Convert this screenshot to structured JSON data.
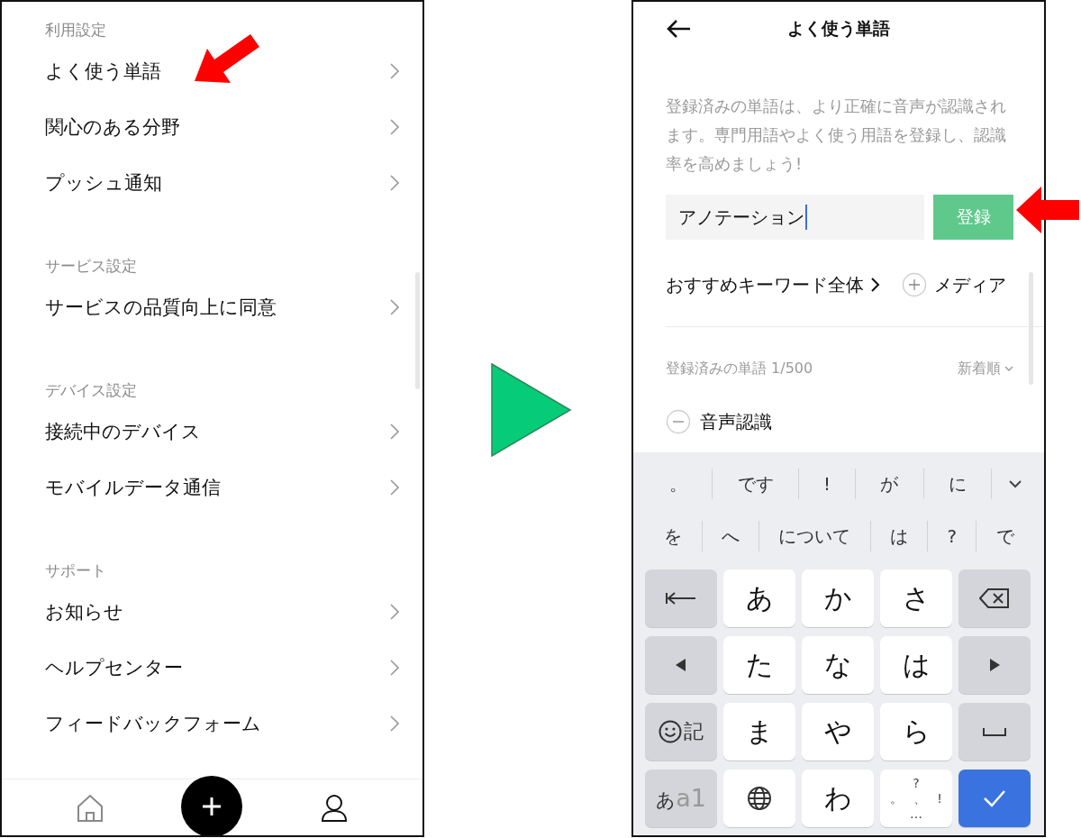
{
  "settings_screen": {
    "sections": [
      {
        "header": "利用設定",
        "items": [
          {
            "label": "よく使う単語"
          },
          {
            "label": "関心のある分野"
          },
          {
            "label": "プッシュ通知"
          }
        ]
      },
      {
        "header": "サービス設定",
        "items": [
          {
            "label": "サービスの品質向上に同意"
          }
        ]
      },
      {
        "header": "デバイス設定",
        "items": [
          {
            "label": "接続中のデバイス"
          },
          {
            "label": "モバイルデータ通信"
          }
        ]
      },
      {
        "header": "サポート",
        "items": [
          {
            "label": "お知らせ"
          },
          {
            "label": "ヘルプセンター"
          },
          {
            "label": "フィードバックフォーム"
          }
        ]
      }
    ]
  },
  "words_screen": {
    "title": "よく使う単語",
    "description": "登録済みの単語は、より正確に音声が認識されます。専門用語やよく使う用語を登録し、認識率を高めましょう!",
    "input": {
      "value": "アノテーション"
    },
    "register_button": "登録",
    "keyword_filters": [
      {
        "kind": "all",
        "label": "おすすめキーワード全体"
      },
      {
        "kind": "add",
        "label": "メディア"
      }
    ],
    "list_header": "登録済みの単語 1/500",
    "sort": "新着順",
    "words": [
      {
        "label": "音声認識"
      }
    ]
  },
  "keyboard": {
    "candidates": [
      [
        "。",
        "です",
        "!",
        "が",
        "に"
      ],
      [
        "を",
        "へ",
        "について",
        "は",
        "?",
        "で"
      ]
    ],
    "keys": [
      {
        "kind": "cursor-back"
      },
      {
        "kind": "char",
        "label": "あ"
      },
      {
        "kind": "char",
        "label": "か"
      },
      {
        "kind": "char",
        "label": "さ"
      },
      {
        "kind": "backspace"
      },
      {
        "kind": "left"
      },
      {
        "kind": "char",
        "label": "た"
      },
      {
        "kind": "char",
        "label": "な"
      },
      {
        "kind": "char",
        "label": "は"
      },
      {
        "kind": "right"
      },
      {
        "kind": "emoji",
        "label": "記"
      },
      {
        "kind": "char",
        "label": "ま"
      },
      {
        "kind": "char",
        "label": "や"
      },
      {
        "kind": "char",
        "label": "ら"
      },
      {
        "kind": "space"
      },
      {
        "kind": "mode",
        "label": "あ",
        "sub": "a1"
      },
      {
        "kind": "globe"
      },
      {
        "kind": "char",
        "label": "わ"
      },
      {
        "kind": "punct",
        "top": "?",
        "middle": [
          "。",
          "、",
          "!"
        ],
        "bottom": "…"
      },
      {
        "kind": "enter"
      }
    ]
  }
}
